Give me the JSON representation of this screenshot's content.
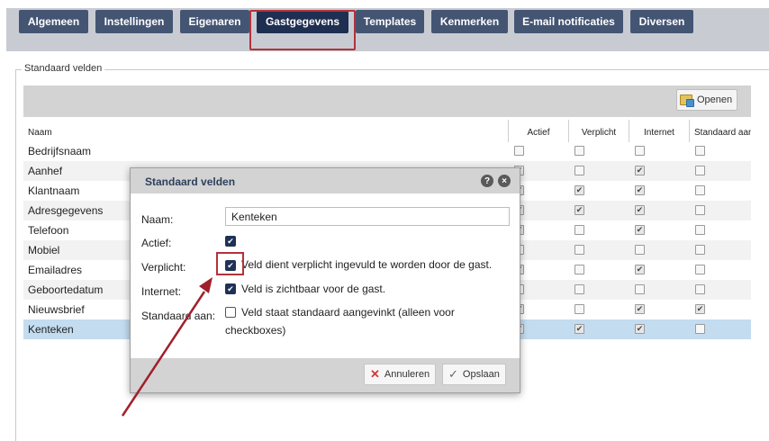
{
  "tabs": [
    {
      "label": "Algemeen",
      "active": false
    },
    {
      "label": "Instellingen",
      "active": false
    },
    {
      "label": "Eigenaren",
      "active": false
    },
    {
      "label": "Gastgegevens",
      "active": true
    },
    {
      "label": "Templates",
      "active": false
    },
    {
      "label": "Kenmerken",
      "active": false
    },
    {
      "label": "E-mail notificaties",
      "active": false
    },
    {
      "label": "Diversen",
      "active": false
    }
  ],
  "section": {
    "legend": "Standaard velden"
  },
  "toolbar": {
    "open_label": "Openen",
    "open_icon": "open-folder-icon"
  },
  "grid": {
    "columns": [
      "Naam",
      "Actief",
      "Verplicht",
      "Internet",
      "Standaard aan"
    ],
    "rows": [
      {
        "name": "Bedrijfsnaam",
        "actief": false,
        "verplicht": false,
        "internet": false,
        "standaard": false
      },
      {
        "name": "Aanhef",
        "actief": true,
        "verplicht": false,
        "internet": true,
        "standaard": false
      },
      {
        "name": "Klantnaam",
        "actief": true,
        "verplicht": true,
        "internet": true,
        "standaard": false
      },
      {
        "name": "Adresgegevens",
        "actief": true,
        "verplicht": true,
        "internet": true,
        "standaard": false
      },
      {
        "name": "Telefoon",
        "actief": true,
        "verplicht": false,
        "internet": true,
        "standaard": false
      },
      {
        "name": "Mobiel",
        "actief": false,
        "verplicht": false,
        "internet": false,
        "standaard": false
      },
      {
        "name": "Emailadres",
        "actief": true,
        "verplicht": false,
        "internet": true,
        "standaard": false
      },
      {
        "name": "Geboortedatum",
        "actief": false,
        "verplicht": false,
        "internet": false,
        "standaard": false
      },
      {
        "name": "Nieuwsbrief",
        "actief": true,
        "verplicht": false,
        "internet": true,
        "standaard": true
      },
      {
        "name": "Kenteken",
        "actief": true,
        "verplicht": true,
        "internet": true,
        "standaard": false,
        "selected": true
      }
    ]
  },
  "dialog": {
    "title": "Standaard velden",
    "help_icon": "help-icon",
    "close_icon": "close-icon",
    "naam_label": "Naam:",
    "naam_value": "Kenteken",
    "actief_label": "Actief:",
    "actief_checked": true,
    "verplicht_label": "Verplicht:",
    "verplicht_checked": true,
    "verplicht_text": "Veld dient verplicht ingevuld te worden door de gast.",
    "internet_label": "Internet:",
    "internet_checked": true,
    "internet_text": "Veld is zichtbaar voor de gast.",
    "standaard_label": "Standaard aan:",
    "standaard_checked": false,
    "standaard_text": "Veld staat standaard aangevinkt (alleen voor checkboxes)",
    "cancel_label": "Annuleren",
    "save_label": "Opslaan"
  },
  "colors": {
    "tab_bg": "#445574",
    "tab_active_bg": "#1f2f52",
    "annotation": "#b3323a",
    "selected_row": "#c3dcf0"
  }
}
